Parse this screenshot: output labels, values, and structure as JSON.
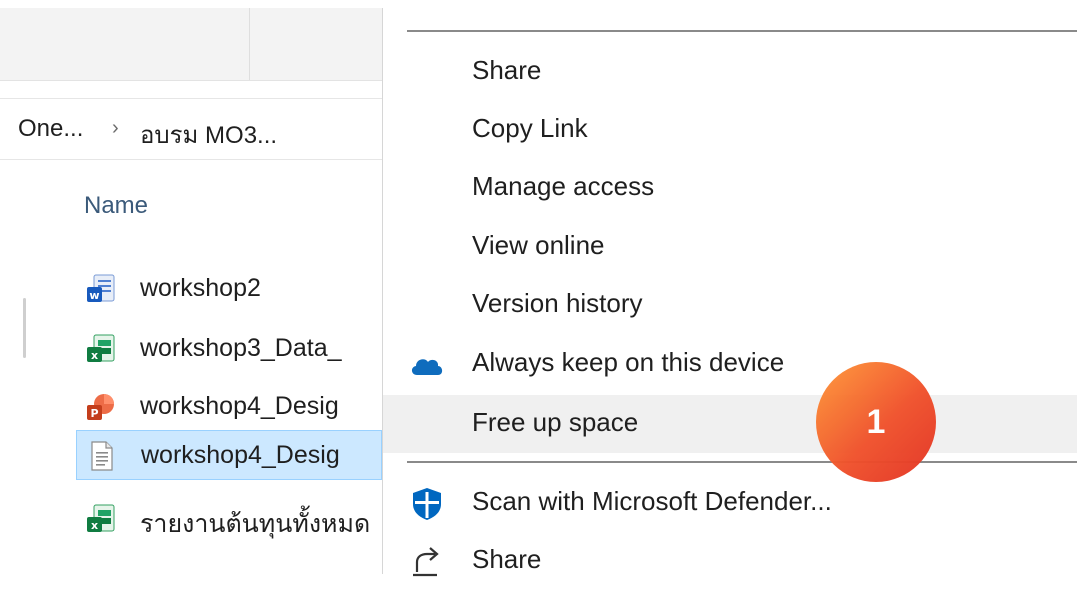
{
  "breadcrumb": {
    "segment1": "One...",
    "separator": "›",
    "segment2": "อบรม MO3..."
  },
  "file_list": {
    "column_header": "Name",
    "files": [
      {
        "name": "workshop2",
        "icon": "word-icon"
      },
      {
        "name": "workshop3_Data_",
        "icon": "excel-icon"
      },
      {
        "name": "workshop4_Desig",
        "icon": "powerpoint-icon"
      },
      {
        "name": "workshop4_Desig",
        "icon": "text-file-icon",
        "selected": true
      },
      {
        "name": "รายงานต้นทุนทั้งหมด",
        "icon": "excel-icon"
      }
    ]
  },
  "context_menu": {
    "items": [
      {
        "label": "Share"
      },
      {
        "label": "Copy Link"
      },
      {
        "label": "Manage access"
      },
      {
        "label": "View online"
      },
      {
        "label": "Version history"
      },
      {
        "label": "Always keep on this device",
        "icon": "onedrive-cloud-icon"
      },
      {
        "label": "Free up space",
        "hovered": true
      },
      {
        "label": "Scan with Microsoft Defender...",
        "icon": "defender-shield-icon"
      },
      {
        "label": "Share",
        "icon": "share-icon"
      }
    ]
  },
  "step_badge": {
    "label": "1"
  },
  "colors": {
    "selected_row": "#cce8ff",
    "onedrive_blue": "#0f6cbd",
    "defender_blue": "#0067c0",
    "badge_orange": "#f0522c"
  }
}
